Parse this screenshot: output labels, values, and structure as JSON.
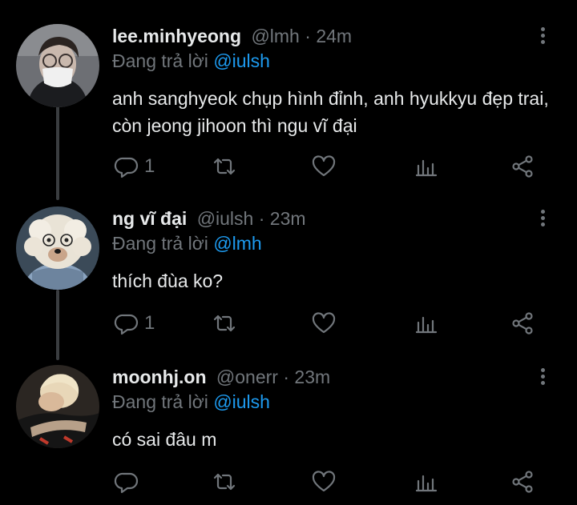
{
  "tweets": [
    {
      "name": "lee.minhyeong",
      "handle": "@lmh",
      "sep": "·",
      "time": "24m",
      "reply_prefix": "Đang trả lời ",
      "reply_to": "@iulsh",
      "text": "anh sanghyeok chụp hình đỉnh, anh hyukkyu đẹp trai, còn jeong jihoon thì ngu vĩ đại",
      "reply_count": "1"
    },
    {
      "name": "ng vĩ đại",
      "handle": "@iulsh",
      "sep": "·",
      "time": "23m",
      "reply_prefix": "Đang trả lời ",
      "reply_to": "@lmh",
      "text": "thích đùa ko?",
      "reply_count": "1"
    },
    {
      "name": "moonhj.on",
      "handle": "@onerr",
      "sep": "·",
      "time": "23m",
      "reply_prefix": "Đang trả lời ",
      "reply_to": "@iulsh",
      "text": "có sai đâu m",
      "reply_count": ""
    }
  ],
  "icons": {
    "reply": "reply-icon",
    "retweet": "retweet-icon",
    "like": "heart-icon",
    "views": "views-icon",
    "share": "share-icon",
    "more": "more-options-icon"
  },
  "colors": {
    "background": "#000000",
    "text": "#e7e9ea",
    "muted": "#71767b",
    "mention": "#1d9bf0"
  }
}
